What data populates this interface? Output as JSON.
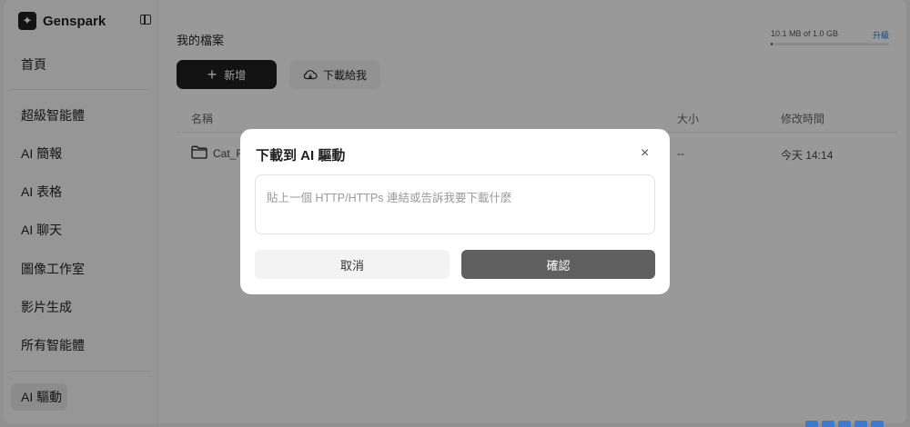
{
  "app": {
    "name": "Genspark"
  },
  "sidebar": {
    "items": [
      {
        "label": "首頁"
      },
      {
        "label": "超級智能體"
      },
      {
        "label": "AI 簡報"
      },
      {
        "label": "AI 表格"
      },
      {
        "label": "AI 聊天"
      },
      {
        "label": "圖像工作室"
      },
      {
        "label": "影片生成"
      },
      {
        "label": "所有智能體"
      },
      {
        "label": "AI 驅動"
      }
    ],
    "active": "AI 驅動"
  },
  "main": {
    "title": "我的檔案",
    "storage": {
      "text": "10.1 MB of 1.0 GB",
      "upgrade": "升級",
      "used_fraction": 0.01
    },
    "new_button": "新增",
    "download_button": "下載給我",
    "table": {
      "headers": {
        "name": "名稱",
        "size": "大小",
        "modified": "修改時間"
      },
      "rows": [
        {
          "name": "Cat_F",
          "size": "--",
          "modified": "今天 14:14"
        }
      ]
    }
  },
  "dialog": {
    "title": "下載到 AI 驅動",
    "close": "×",
    "input_placeholder": "貼上一個 HTTP/HTTPs 連結或告訴我要下載什麼",
    "cancel": "取消",
    "confirm": "確認"
  },
  "colors": {
    "primary": "#1f1f1f",
    "confirm": "#5f5f5f",
    "accent": "#1a73e8"
  }
}
